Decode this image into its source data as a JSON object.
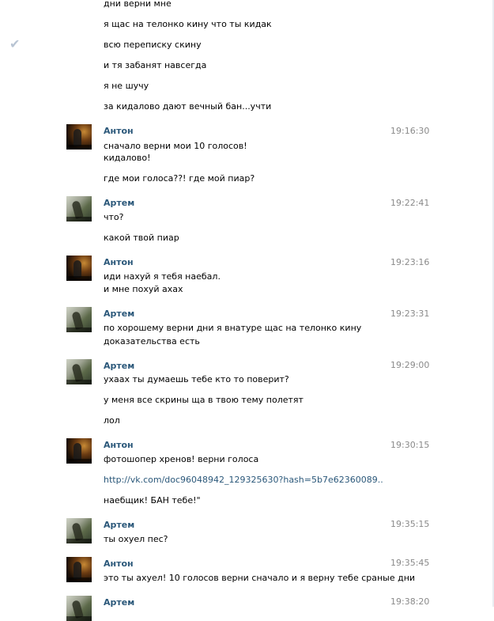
{
  "leading_lines": [
    "дни верни мне",
    "я щас на телонко кину что ты кидак",
    "всю переписку скину",
    "и тя забанят навсегда",
    "я не шучу",
    "за кидалово дают вечный бан...учти"
  ],
  "messages": [
    {
      "author": "Антон",
      "time": "19:16:30",
      "avatar": "anton",
      "lines": [
        "сначало верни мои 10 голосов!",
        "кидалово!",
        "где мои голоса??! где мой пиар?"
      ]
    },
    {
      "author": "Артем",
      "time": "19:22:41",
      "avatar": "artem",
      "lines": [
        "что?",
        "какой твой пиар"
      ]
    },
    {
      "author": "Антон",
      "time": "19:23:16",
      "avatar": "anton",
      "lines": [
        "иди нахуй я тебя наебал.",
        "и мне похуй ахах"
      ]
    },
    {
      "author": "Артем",
      "time": "19:23:31",
      "avatar": "artem",
      "lines": [
        "по хорошему верни дни я внатуре щас на телонко кину",
        "доказательства есть"
      ]
    },
    {
      "author": "Артем",
      "time": "19:29:00",
      "avatar": "artem",
      "lines": [
        "ухаах ты думаешь тебе кто то поверит?",
        "у меня все скрины ща в твою тему полетят",
        "лол"
      ]
    },
    {
      "author": "Антон",
      "time": "19:30:15",
      "avatar": "anton",
      "lines": [
        "фотошопер хренов! верни голоса",
        "http://vk.com/doc96048942_129325630?hash=5b7e62360089..",
        "наебщик! БАН тебе!\""
      ]
    },
    {
      "author": "Артем",
      "time": "19:35:15",
      "avatar": "artem",
      "lines": [
        "ты охуел пес?"
      ]
    },
    {
      "author": "Антон",
      "time": "19:35:45",
      "avatar": "anton",
      "lines": [
        "это ты ахуел! 10 голосов верни сначало и я верну тебе сраные дни"
      ]
    },
    {
      "author": "Артем",
      "time": "19:38:20",
      "avatar": "artem",
      "lines": []
    }
  ],
  "icons": {
    "read_mark": "checkmark-icon"
  },
  "colors": {
    "author": "#2b587a",
    "time": "#8a8a8a",
    "link": "#2b587a"
  }
}
